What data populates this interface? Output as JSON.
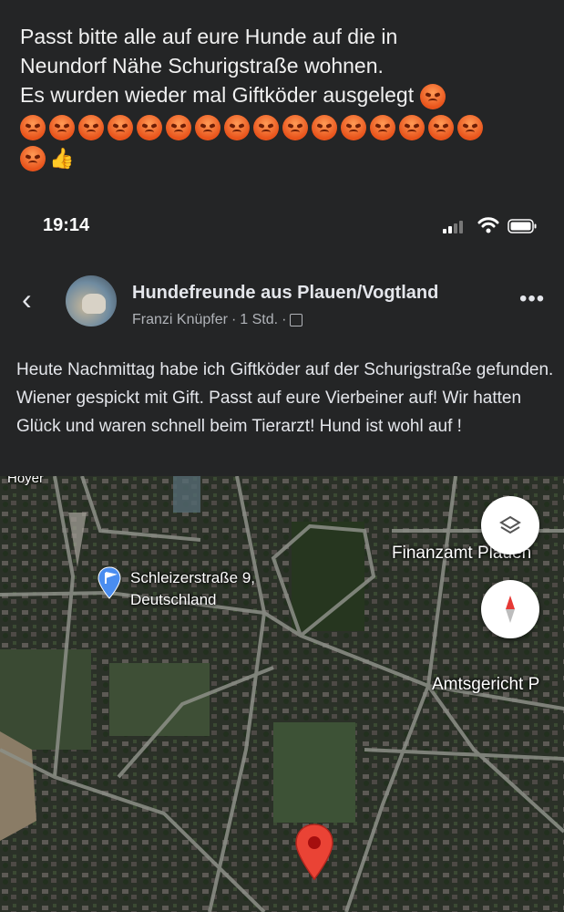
{
  "caption": {
    "line1": "Passt bitte alle auf eure Hunde auf die in",
    "line2": "Neundorf Nähe Schurigstraße wohnen.",
    "line3": "Es wurden wieder mal Giftköder ausgelegt"
  },
  "status": {
    "time": "19:14"
  },
  "post": {
    "group_name": "Hundefreunde aus Plauen/Vogtland",
    "author": "Franzi Knüpfer",
    "time_ago": "1 Std.",
    "body": "Heute Nachmittag habe ich Giftköder auf der Schurigstraße gefunden. Wiener gespickt mit Gift. Passt auf eure Vierbeiner auf! Wir hatten Glück und waren schnell beim Tierarzt! Hund ist wohl auf !"
  },
  "map": {
    "label_top_left": "Hoyer",
    "pin_label_line1": "Schleizerstraße 9,",
    "pin_label_line2": "Deutschland",
    "label_finanzamt": "Finanzamt Plauen",
    "label_amtsgericht": "Amtsgericht P"
  }
}
